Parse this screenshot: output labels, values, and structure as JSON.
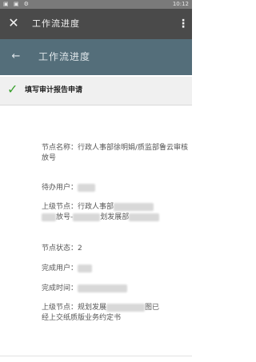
{
  "status_bar": {
    "icons": "▣ ▣ ⚙",
    "time": "10:12"
  },
  "app_bar": {
    "title": "工作流进度"
  },
  "sub_bar": {
    "title": "工作流进度"
  },
  "step": {
    "label": "填写审计报告申请"
  },
  "detail": {
    "node_name": "节点名称：行政人事部徐明娟/质监部鲁云审核放号",
    "pending_user": "待办用户：",
    "parent_node_a": "上级节点：行政人事部",
    "parent_node_b": "放号-",
    "parent_node_c": "划发展部",
    "node_status": "节点状态：2",
    "done_user": "完成用户：",
    "done_time": "完成时间：",
    "parent_node2_a": "上级节点：规划发展",
    "parent_node2_b": "图已",
    "parent_node2_c": "经上交纸质版业务约定书"
  }
}
